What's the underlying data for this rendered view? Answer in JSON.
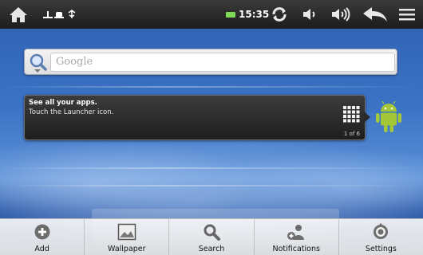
{
  "status_bar": {
    "time": "15:35",
    "icons": [
      "home-icon",
      "usb-icon",
      "android-debug-icon",
      "usb-connected-icon",
      "battery-icon",
      "sync-icon",
      "volume-down-icon",
      "volume-up-icon",
      "back-icon",
      "menu-icon"
    ]
  },
  "search_widget": {
    "placeholder": "Google",
    "icon": "search-icon"
  },
  "tooltip": {
    "title": "See all your apps.",
    "body": "Touch the Launcher icon.",
    "page_indicator": "1 of 6"
  },
  "options_menu": {
    "items": [
      {
        "label": "Add",
        "icon": "add-icon"
      },
      {
        "label": "Wallpaper",
        "icon": "wallpaper-icon"
      },
      {
        "label": "Search",
        "icon": "search-icon"
      },
      {
        "label": "Notifications",
        "icon": "notifications-icon"
      },
      {
        "label": "Settings",
        "icon": "settings-icon"
      }
    ]
  },
  "colors": {
    "status_bar": "#1c1c1c",
    "battery": "#7ed957",
    "wallpaper": "#3a72c4",
    "android_green": "#a4c639"
  }
}
